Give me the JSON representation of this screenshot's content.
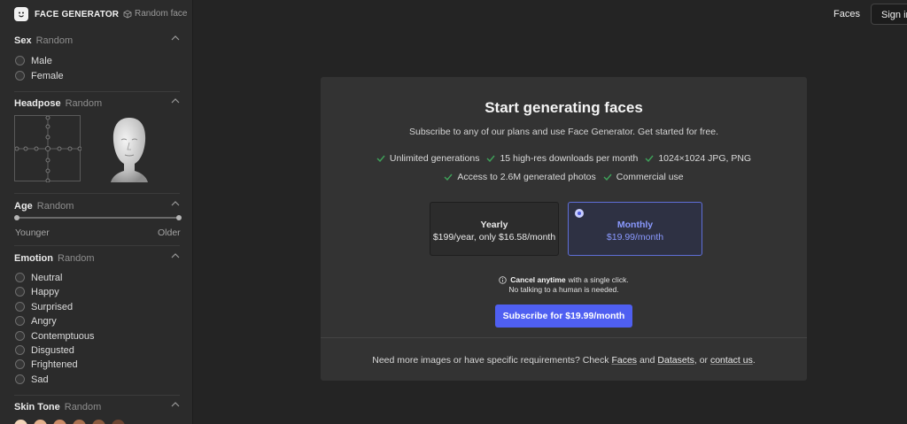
{
  "brand": {
    "name": "FACE GENERATOR",
    "random_face": "Random face"
  },
  "nav": {
    "faces": "Faces",
    "sign_in": "Sign in"
  },
  "sidebar": {
    "sex": {
      "title": "Sex",
      "value": "Random",
      "options": [
        "Male",
        "Female"
      ]
    },
    "headpose": {
      "title": "Headpose",
      "value": "Random"
    },
    "age": {
      "title": "Age",
      "value": "Random",
      "min_label": "Younger",
      "max_label": "Older"
    },
    "emotion": {
      "title": "Emotion",
      "value": "Random",
      "options": [
        "Neutral",
        "Happy",
        "Surprised",
        "Angry",
        "Contemptuous",
        "Disgusted",
        "Frightened",
        "Sad"
      ]
    },
    "skin_tone": {
      "title": "Skin Tone",
      "value": "Random",
      "swatches": [
        "#f1d3b8",
        "#e2b08c",
        "#c98a66",
        "#a8704f",
        "#8a5a3e",
        "#6a4330"
      ]
    }
  },
  "modal": {
    "title": "Start generating faces",
    "subtitle": "Subscribe to any of our plans and use Face Generator. Get started for free.",
    "features_row1": [
      "Unlimited generations",
      "15 high-res downloads per month",
      "1024×1024 JPG, PNG"
    ],
    "features_row2": [
      "Access to 2.6M generated photos",
      "Commercial use"
    ],
    "plans": {
      "yearly": {
        "name": "Yearly",
        "price": "$199/year, only $16.58/month"
      },
      "monthly": {
        "name": "Monthly",
        "price": "$19.99/month",
        "selected": true
      }
    },
    "cancel_bold": "Cancel anytime",
    "cancel_rest": "with a single click.",
    "cancel_line2": "No talking to a human is needed.",
    "cta": "Subscribe for $19.99/month",
    "footer": {
      "prefix": "Need more images or have specific requirements? Check",
      "link_faces": "Faces",
      "and": "and",
      "link_datasets": "Datasets",
      "or": ", or",
      "link_contact": "contact us",
      "suffix": "."
    }
  },
  "colors": {
    "accent": "#4f5ff1",
    "selected_text": "#8a99ff",
    "check": "#3fa35a"
  }
}
